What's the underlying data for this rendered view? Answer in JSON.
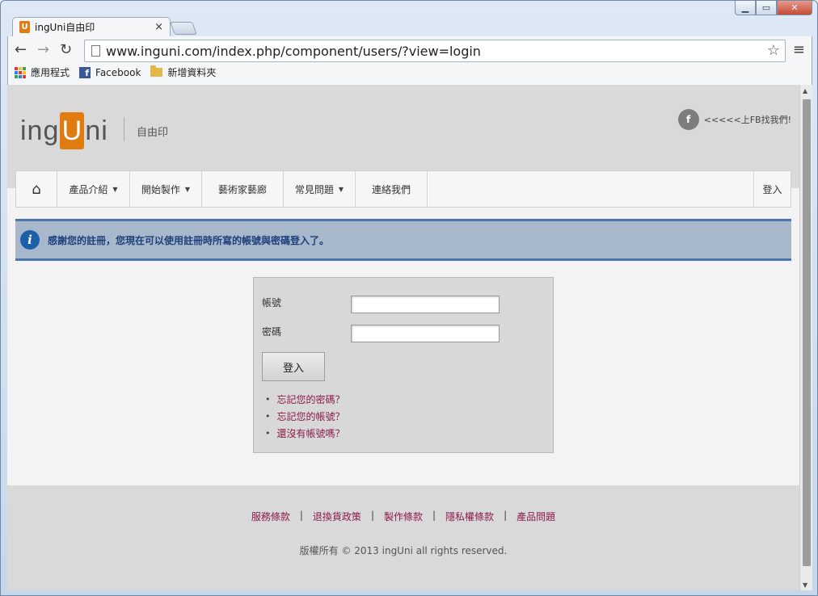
{
  "browser": {
    "tab_title": "ingUni自由印",
    "tab_favicon_letter": "U",
    "url": "www.inguni.com/index.php/component/users/?view=login",
    "window_controls": [
      "minimize",
      "maximize",
      "close"
    ],
    "bookmarks": [
      {
        "label": "應用程式",
        "icon": "apps-icon"
      },
      {
        "label": "Facebook",
        "icon": "facebook-icon"
      },
      {
        "label": "新增資料夾",
        "icon": "folder-icon"
      }
    ]
  },
  "site": {
    "logo": {
      "prefix": "ing",
      "highlight": "U",
      "suffix": "ni"
    },
    "tagline": "自由印",
    "fb_link": "<<<<<上FB找我們!",
    "fb_icon_letter": "f"
  },
  "nav": {
    "home_icon": "home-icon",
    "items": [
      {
        "label": "產品介紹",
        "dropdown": true
      },
      {
        "label": "開始製作",
        "dropdown": true
      },
      {
        "label": "藝術家藝廊",
        "dropdown": false
      },
      {
        "label": "常見問題",
        "dropdown": true
      },
      {
        "label": "連絡我們",
        "dropdown": false
      }
    ],
    "login": "登入"
  },
  "alert": {
    "icon": "info-icon",
    "text": "感謝您的註冊，您現在可以使用註冊時所寫的帳號與密碼登入了。"
  },
  "login_form": {
    "username_label": "帳號",
    "username_value": "",
    "password_label": "密碼",
    "password_value": "",
    "submit_label": "登入",
    "links": [
      "忘記您的密碼？",
      "忘記您的帳號？",
      "還沒有帳號嗎？"
    ]
  },
  "footer": {
    "links": [
      "服務條款",
      "退換貨政策",
      "製作條款",
      "隱私權條款",
      "產品問題"
    ],
    "copyright": "版權所有 © 2013  ingUni  all rights reserved."
  },
  "colors": {
    "brand_orange": "#e07b10",
    "link": "#8a1a4a",
    "alert_bg": "#a7b8cc",
    "alert_border": "#4a75ad"
  }
}
